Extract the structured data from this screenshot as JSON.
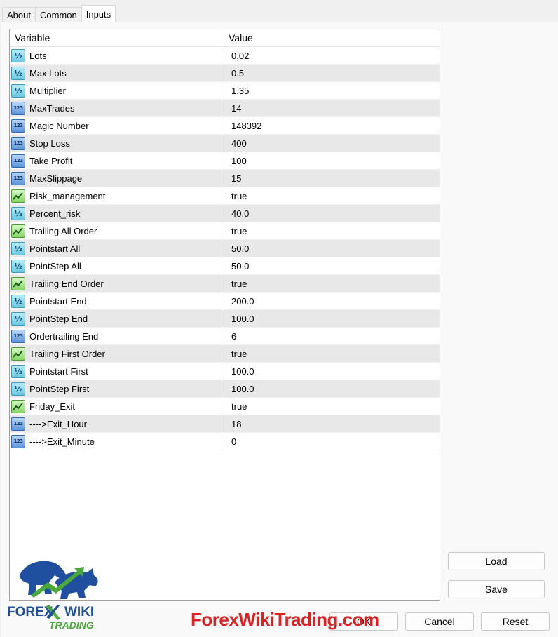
{
  "tabs": [
    {
      "label": "About"
    },
    {
      "label": "Common"
    },
    {
      "label": "Inputs"
    }
  ],
  "grid": {
    "header": {
      "variable": "Variable",
      "value": "Value"
    },
    "rows": [
      {
        "icon": "double-icon",
        "name": "Lots",
        "value": "0.02"
      },
      {
        "icon": "double-icon",
        "name": "Max Lots",
        "value": "0.5"
      },
      {
        "icon": "double-icon",
        "name": "Multiplier",
        "value": "1.35"
      },
      {
        "icon": "int-icon",
        "name": "MaxTrades",
        "value": "14"
      },
      {
        "icon": "int-icon",
        "name": "Magic Number",
        "value": "148392"
      },
      {
        "icon": "int-icon",
        "name": "Stop Loss",
        "value": "400"
      },
      {
        "icon": "int-icon",
        "name": "Take Profit",
        "value": "100"
      },
      {
        "icon": "int-icon",
        "name": "MaxSlippage",
        "value": "15"
      },
      {
        "icon": "bool-icon",
        "name": "Risk_management",
        "value": "true"
      },
      {
        "icon": "double-icon",
        "name": "Percent_risk",
        "value": "40.0"
      },
      {
        "icon": "bool-icon",
        "name": "Trailing All Order",
        "value": "true"
      },
      {
        "icon": "double-icon",
        "name": "Pointstart All",
        "value": "50.0"
      },
      {
        "icon": "double-icon",
        "name": "PointStep All",
        "value": "50.0"
      },
      {
        "icon": "bool-icon",
        "name": "Trailing End Order",
        "value": "true"
      },
      {
        "icon": "double-icon",
        "name": "Pointstart End",
        "value": "200.0"
      },
      {
        "icon": "double-icon",
        "name": "PointStep End",
        "value": "100.0"
      },
      {
        "icon": "int-icon",
        "name": "Ordertrailing End",
        "value": "6"
      },
      {
        "icon": "bool-icon",
        "name": "Trailing First Order",
        "value": "true"
      },
      {
        "icon": "double-icon",
        "name": "Pointstart First",
        "value": "100.0"
      },
      {
        "icon": "double-icon",
        "name": "PointStep First",
        "value": "100.0"
      },
      {
        "icon": "bool-icon",
        "name": "Friday_Exit",
        "value": "true"
      },
      {
        "icon": "int-icon",
        "name": "---->Exit_Hour",
        "value": "18"
      },
      {
        "icon": "int-icon",
        "name": "---->Exit_Minute",
        "value": "0"
      }
    ]
  },
  "icon_glyphs": {
    "double": "½",
    "int": "123"
  },
  "buttons": {
    "load": "Load",
    "save": "Save",
    "ok": "OK",
    "cancel": "Cancel",
    "reset": "Reset"
  },
  "logo": {
    "line1": "FOREX",
    "line2": "WIKI",
    "line3": "TRADING"
  },
  "watermark": "ForexWikiTrading.com",
  "colors": {
    "logo_blue": "#1f4f9e",
    "logo_green": "#4aa83a",
    "watermark_red": "#e02020"
  }
}
